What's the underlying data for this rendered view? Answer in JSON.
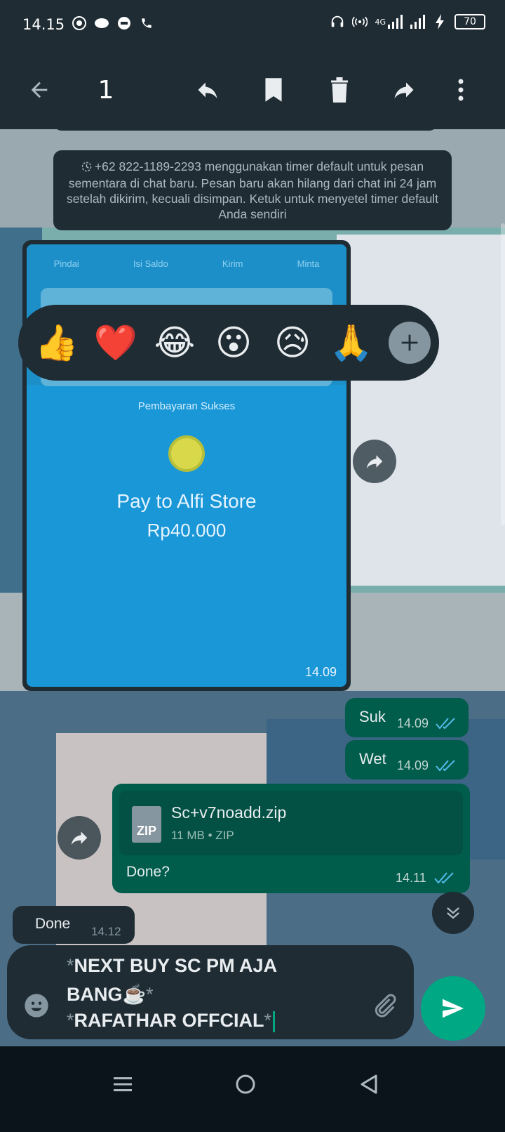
{
  "status_bar": {
    "time": "14.15",
    "network": "4G",
    "battery": "70"
  },
  "selection_bar": {
    "selected_count": "1"
  },
  "system_message": {
    "text": "+62 822-1189-2293 menggunakan timer default untuk pesan sementara di chat baru. Pesan baru akan hilang dari chat ini 24 jam setelah dikirim, kecuali disimpan. Ketuk untuk menyetel timer default Anda sendiri"
  },
  "image_message": {
    "tabs": [
      "Pindai",
      "Isi Saldo",
      "Kirim",
      "Minta"
    ],
    "title": "Pembayaran Sukses",
    "pay_to": "Pay to Alfi Store",
    "amount": "Rp40.000",
    "time": "14.09"
  },
  "reactions": [
    "👍",
    "❤️",
    "😂",
    "😮",
    "😥",
    "🙏"
  ],
  "outgoing": [
    {
      "text": "Suk",
      "time": "14.09"
    },
    {
      "text": "Wet",
      "time": "14.09"
    }
  ],
  "document_message": {
    "filename": "Sc+v7noadd.zip",
    "meta": "11 MB • ZIP",
    "icon_label": "ZIP",
    "caption": "Done?",
    "time": "14.11"
  },
  "incoming_message": {
    "text": "Done",
    "time": "14.12"
  },
  "composer": {
    "line1": "NEXT BUY SC PM AJA",
    "line2": "BANG☕",
    "line3": "RAFATHAR OFFCIAL",
    "marker": "*"
  },
  "colors": {
    "bar": "#1f2c34",
    "outgoing": "#005c4b",
    "accent": "#00a884",
    "read_ticks": "#53bdeb"
  }
}
